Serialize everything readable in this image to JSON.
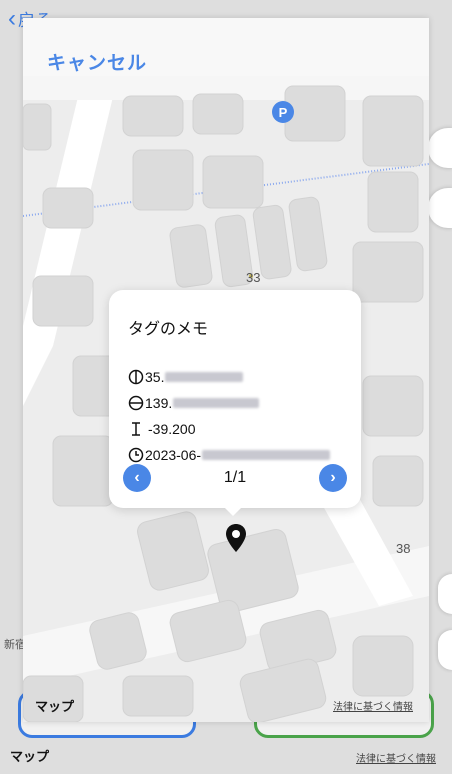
{
  "background": {
    "back_label": "戻る",
    "area_label": "新宿",
    "maps_logo": "マップ",
    "legal_link": "法律に基づく情報"
  },
  "sheet": {
    "cancel_label": "キャンセル"
  },
  "map": {
    "poi_parking": "P",
    "block_label_1": "33",
    "block_label_2": "38",
    "maps_logo": "マップ",
    "legal_link": "法律に基づく情報"
  },
  "callout": {
    "title": "タグのメモ",
    "latitude_prefix": "35.",
    "longitude_prefix": "139.",
    "altitude": "-39.200",
    "date_prefix": "2023-06-",
    "page_indicator": "1/1",
    "prev_label": "‹",
    "next_label": "›"
  },
  "icons": {
    "latitude": "latitude-icon",
    "longitude": "longitude-icon",
    "altitude": "altitude-icon",
    "time": "clock-icon",
    "pin": "map-pin-icon"
  },
  "colors": {
    "accent": "#4a87e6",
    "secondary_button": "#4aa34a"
  }
}
